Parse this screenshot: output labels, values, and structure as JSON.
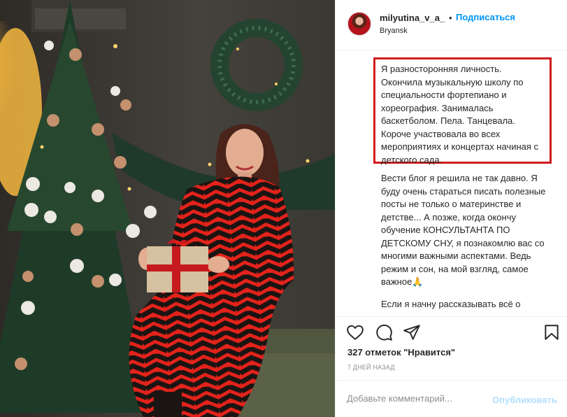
{
  "post": {
    "username": "milyutina_v_a_",
    "separator": "•",
    "follow_label": "Подписаться",
    "location": "Bryansk"
  },
  "caption": {
    "para1": "Я разносторонняя личность. Окончила музыкальную школу по специальности фортепиано и хореография. Занималась баскетболом. Пела. Танцевала. Короче участвовала во всех мероприятиях и концертах начиная с детского сада.",
    "para2": "Вести блог я решила не так давно. Я буду очень стараться писать полезные посты не только о материнстве и детстве... А позже, когда окончу обучение КОНСУЛЬТАНТА ПО ДЕТСКОМУ СНУ, я познакомлю вас со многими важными аспектами. Ведь режим и сон, на мой взгляд, самое важное🙏",
    "para3": "Если я начну рассказывать всё о"
  },
  "actions": {
    "like_icon": "heart-icon",
    "comment_icon": "comment-icon",
    "share_icon": "paper-plane-icon",
    "save_icon": "bookmark-icon"
  },
  "likes_text": "327 отметок \"Нравится\"",
  "date_text": "7 ДНЕЙ НАЗАД",
  "comment": {
    "placeholder": "Добавьте комментарий...",
    "publish_label": "Опубликовать"
  },
  "colors": {
    "accent": "#0095f6",
    "publish_disabled": "#b2dffc",
    "highlight_border": "#d11c1c",
    "muted": "#8e8e8e"
  }
}
